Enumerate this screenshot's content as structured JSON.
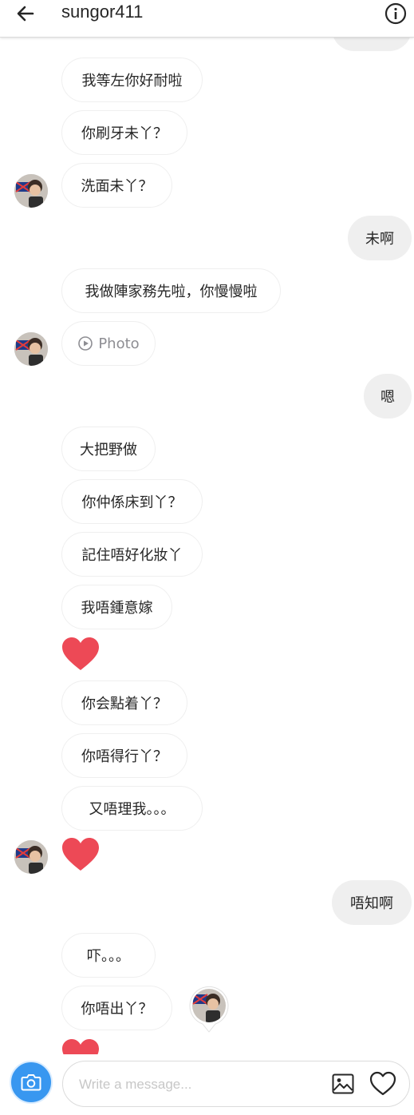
{
  "header": {
    "title": "sungor411",
    "back_icon": "arrow-left-icon",
    "info_icon": "info-icon"
  },
  "messages": [
    {
      "side": "in",
      "text": "我等左你好耐啦"
    },
    {
      "side": "in",
      "text": "你刷牙未丫？"
    },
    {
      "side": "in",
      "text": "洗面未丫？"
    },
    {
      "side": "out",
      "text": "未啊"
    },
    {
      "side": "in",
      "text": "我做陣家務先啦，你慢慢啦"
    },
    {
      "side": "in",
      "text": "Photo",
      "icon": "play-circle-icon"
    },
    {
      "side": "out",
      "text": "嗯"
    },
    {
      "side": "in",
      "text": "大把野做"
    },
    {
      "side": "in",
      "text": "你仲係床到丫？"
    },
    {
      "side": "in",
      "text": "記住唔好化妝丫"
    },
    {
      "side": "in",
      "text": "我唔鍾意嫁"
    },
    {
      "side": "in",
      "type": "heart"
    },
    {
      "side": "in",
      "text": "你会點着丫？"
    },
    {
      "side": "in",
      "text": "你唔得行丫？"
    },
    {
      "side": "in",
      "text": "又唔理我。。。"
    },
    {
      "side": "in",
      "type": "heart"
    },
    {
      "side": "out",
      "text": "唔知啊"
    },
    {
      "side": "in",
      "text": "吓。。。"
    },
    {
      "side": "in",
      "text": "你唔出丫？"
    },
    {
      "side": "in",
      "type": "heart"
    }
  ],
  "composer": {
    "placeholder": "Write a message...",
    "camera_icon": "camera-icon",
    "gallery_icon": "image-icon",
    "like_icon": "heart-outline-icon"
  },
  "colors": {
    "accent": "#3897f0",
    "heart": "#ed4956",
    "outgoing_bubble": "#efefef",
    "border": "#dbdbdb"
  }
}
